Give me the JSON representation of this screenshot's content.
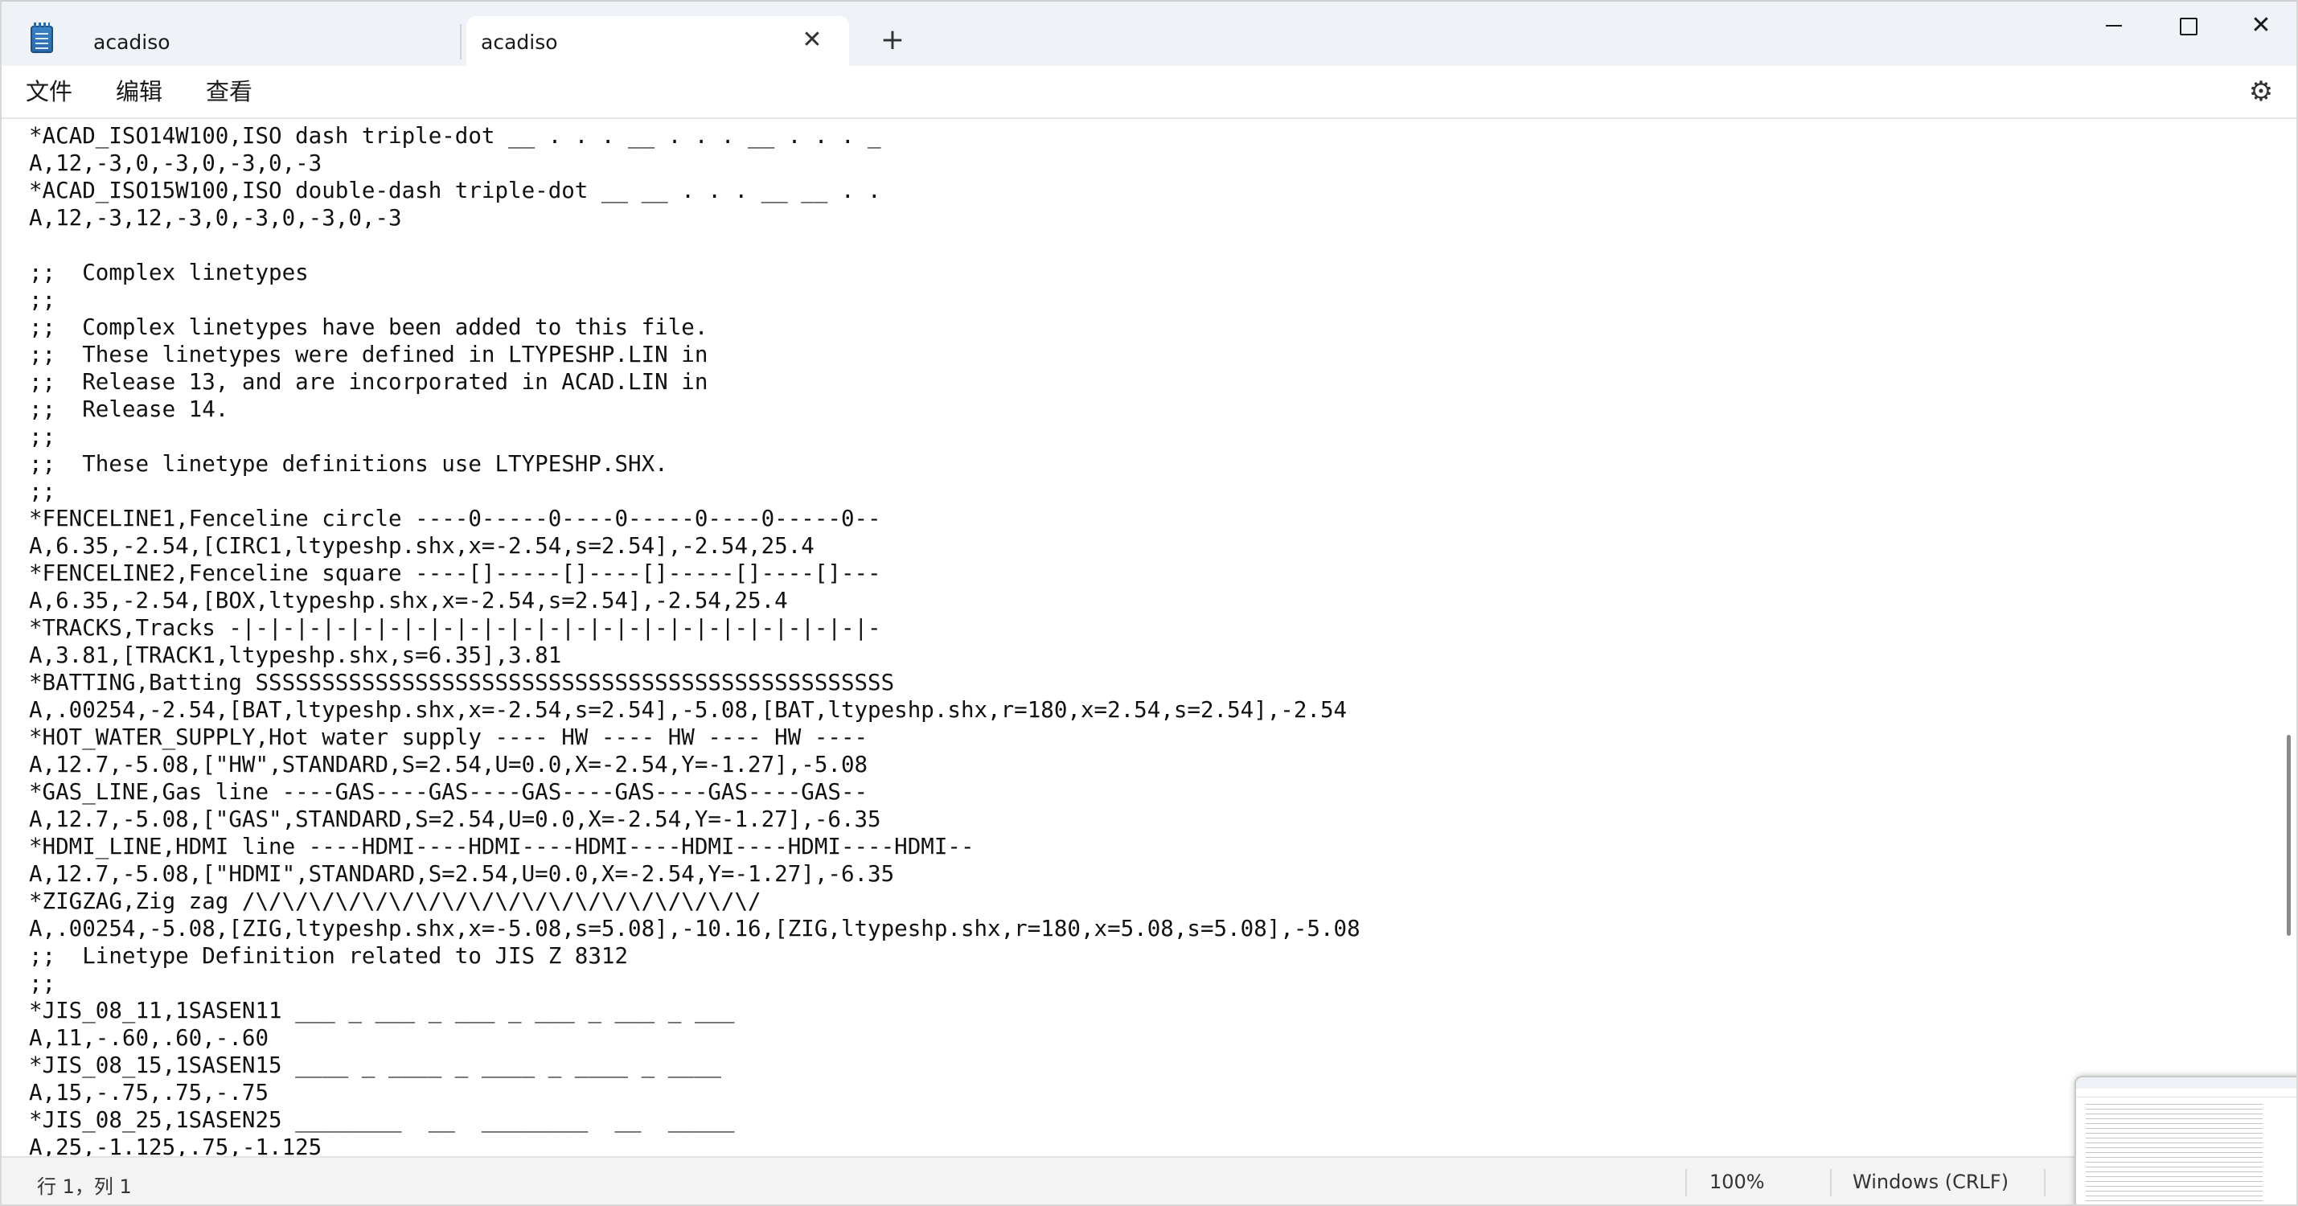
{
  "window": {
    "tabs": [
      {
        "label": "acadiso",
        "active": false
      },
      {
        "label": "acadiso",
        "active": true
      }
    ],
    "tab_close_glyph": "✕",
    "new_tab_glyph": "+",
    "close_glyph": "✕",
    "icons": {
      "app": "notepad-icon",
      "minimize": "minimize-icon",
      "maximize": "maximize-icon",
      "close": "close-icon",
      "settings": "gear-icon"
    }
  },
  "menu": {
    "file": "文件",
    "edit": "编辑",
    "view": "查看",
    "settings_glyph": "⚙"
  },
  "editor": {
    "lines": [
      "*ACAD_ISO14W100,ISO dash triple-dot __ . . . __ . . . __ . . . _",
      "A,12,-3,0,-3,0,-3,0,-3",
      "*ACAD_ISO15W100,ISO double-dash triple-dot __ __ . . . __ __ . .",
      "A,12,-3,12,-3,0,-3,0,-3,0,-3",
      "",
      ";;  Complex linetypes",
      ";;",
      ";;  Complex linetypes have been added to this file.",
      ";;  These linetypes were defined in LTYPESHP.LIN in",
      ";;  Release 13, and are incorporated in ACAD.LIN in",
      ";;  Release 14.",
      ";;",
      ";;  These linetype definitions use LTYPESHP.SHX.",
      ";;",
      "*FENCELINE1,Fenceline circle ----0-----0----0-----0----0-----0--",
      "A,6.35,-2.54,[CIRC1,ltypeshp.shx,x=-2.54,s=2.54],-2.54,25.4",
      "*FENCELINE2,Fenceline square ----[]-----[]----[]-----[]----[]---",
      "A,6.35,-2.54,[BOX,ltypeshp.shx,x=-2.54,s=2.54],-2.54,25.4",
      "*TRACKS,Tracks -|-|-|-|-|-|-|-|-|-|-|-|-|-|-|-|-|-|-|-|-|-|-|-|-",
      "A,3.81,[TRACK1,ltypeshp.shx,s=6.35],3.81",
      "*BATTING,Batting SSSSSSSSSSSSSSSSSSSSSSSSSSSSSSSSSSSSSSSSSSSSSSSS",
      "A,.00254,-2.54,[BAT,ltypeshp.shx,x=-2.54,s=2.54],-5.08,[BAT,ltypeshp.shx,r=180,x=2.54,s=2.54],-2.54",
      "*HOT_WATER_SUPPLY,Hot water supply ---- HW ---- HW ---- HW ----",
      "A,12.7,-5.08,[\"HW\",STANDARD,S=2.54,U=0.0,X=-2.54,Y=-1.27],-5.08",
      "*GAS_LINE,Gas line ----GAS----GAS----GAS----GAS----GAS----GAS--",
      "A,12.7,-5.08,[\"GAS\",STANDARD,S=2.54,U=0.0,X=-2.54,Y=-1.27],-6.35",
      "*HDMI_LINE,HDMI line ----HDMI----HDMI----HDMI----HDMI----HDMI----HDMI--",
      "A,12.7,-5.08,[\"HDMI\",STANDARD,S=2.54,U=0.0,X=-2.54,Y=-1.27],-6.35",
      "*ZIGZAG,Zig zag /\\/\\/\\/\\/\\/\\/\\/\\/\\/\\/\\/\\/\\/\\/\\/\\/\\/\\/\\/",
      "A,.00254,-5.08,[ZIG,ltypeshp.shx,x=-5.08,s=5.08],-10.16,[ZIG,ltypeshp.shx,r=180,x=5.08,s=5.08],-5.08",
      ";;  Linetype Definition related to JIS Z 8312",
      ";;",
      "*JIS_08_11,1SASEN11 ___ _ ___ _ ___ _ ___ _ ___ _ ___",
      "A,11,-.60,.60,-.60",
      "*JIS_08_15,1SASEN15 ____ _ ____ _ ____ _ ____ _ ____",
      "A,15,-.75,.75,-.75",
      "*JIS_08_25,1SASEN25 ________  __  ________  __  _____",
      "A,25,-1.125,.75,-1.125"
    ]
  },
  "status": {
    "position": "行 1，列 1",
    "zoom": "100%",
    "line_ending": "Windows (CRLF)"
  }
}
